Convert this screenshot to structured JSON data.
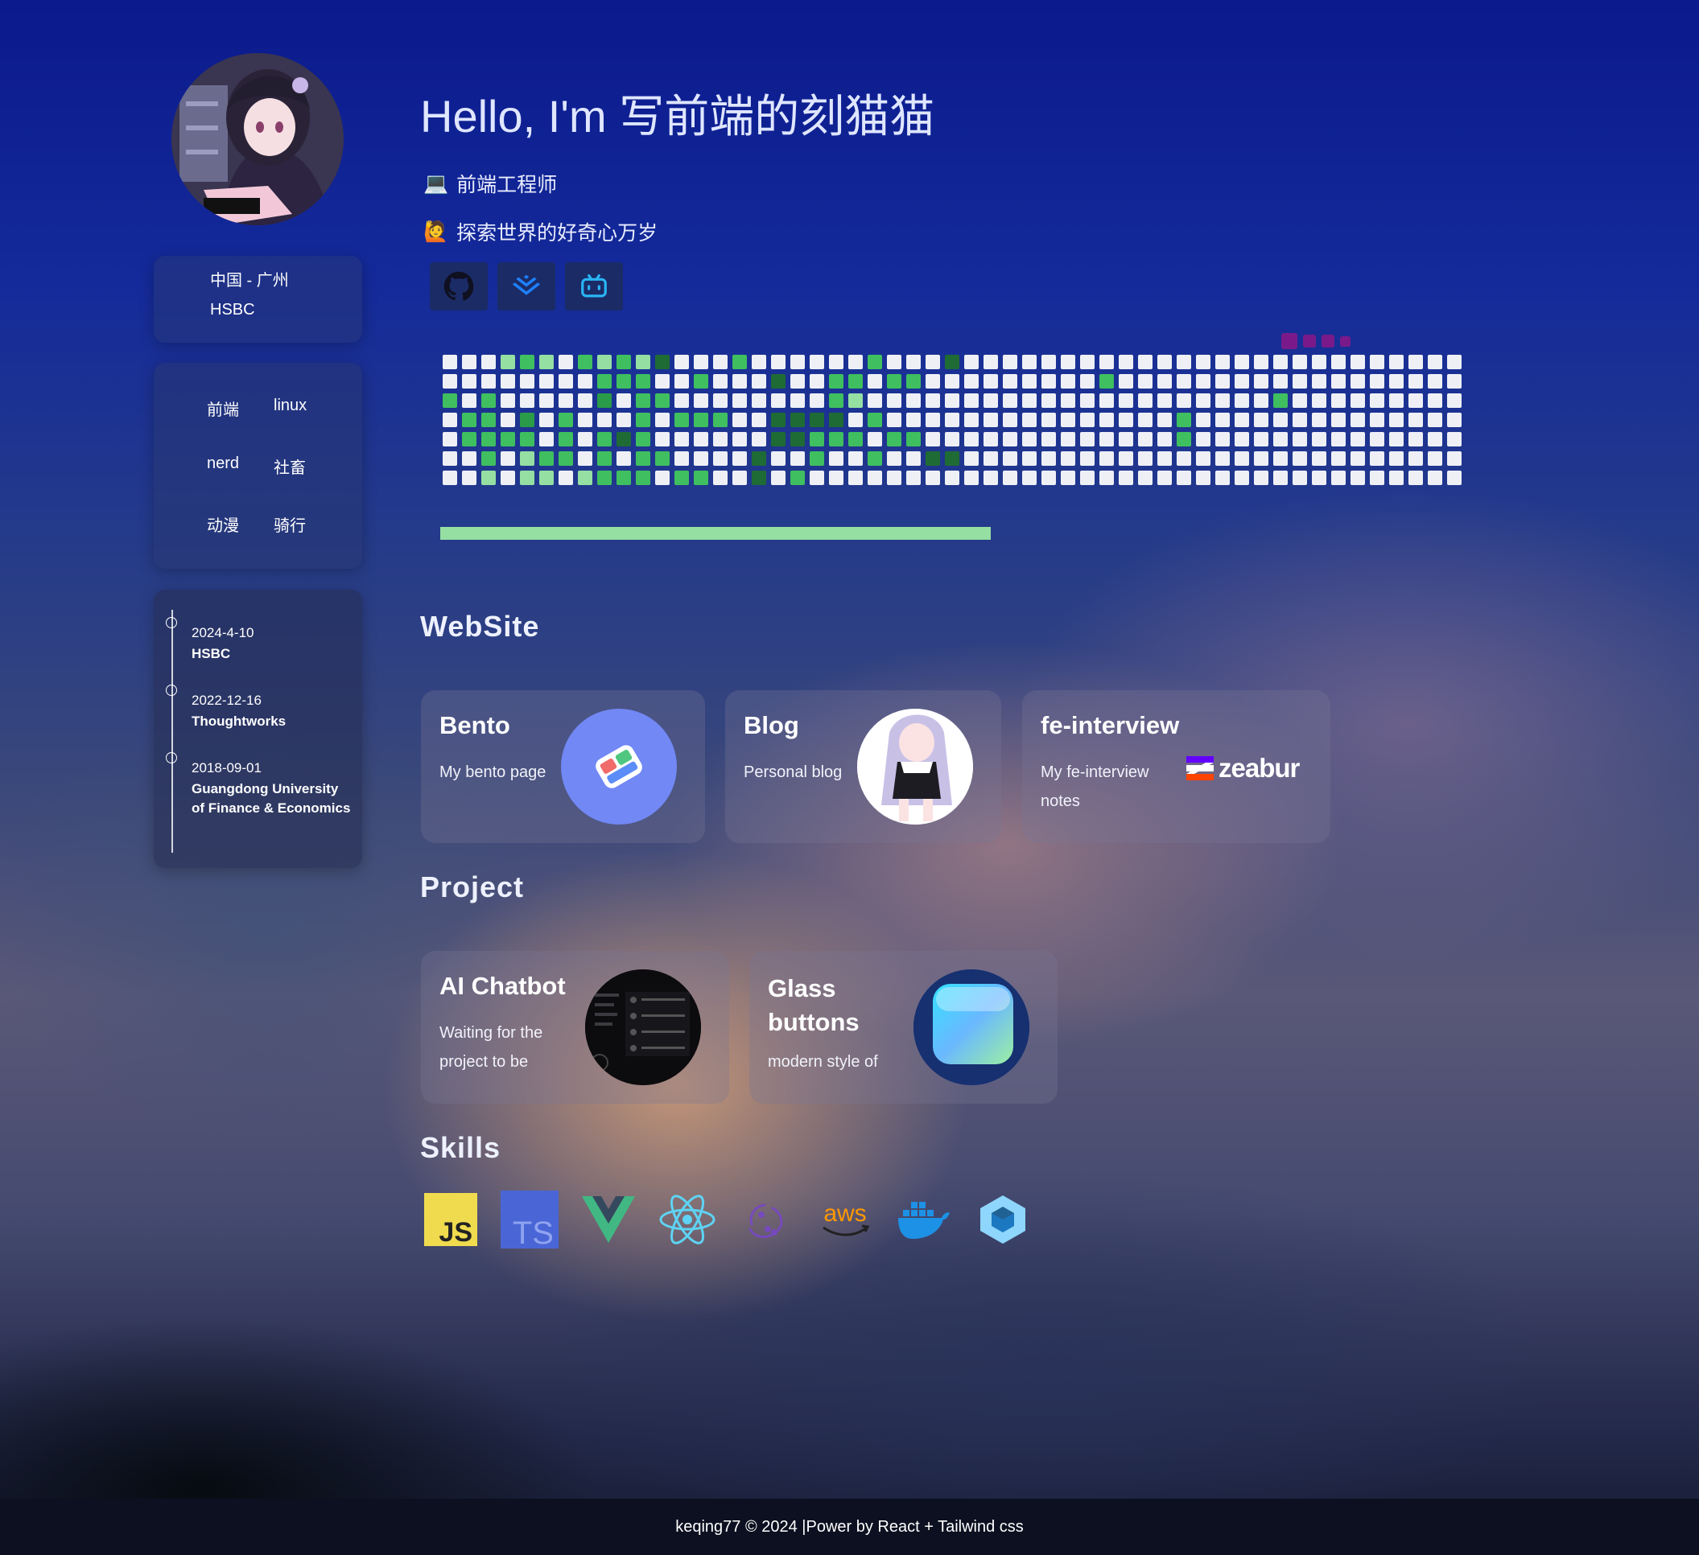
{
  "profile": {
    "location": "中国 - 广州",
    "company": "HSBC",
    "avatar_alt": "anime-girl-avatar"
  },
  "tags": [
    "前端",
    "linux",
    "nerd",
    "社畜",
    "动漫",
    "骑行"
  ],
  "timeline": [
    {
      "date": "2024-4-10",
      "org": "HSBC"
    },
    {
      "date": "2022-12-16",
      "org": "Thoughtworks"
    },
    {
      "date": "2018-09-01",
      "org": "Guangdong University of Finance & Economics"
    }
  ],
  "hero": {
    "greeting": "Hello, I'm 写前端的刻猫猫",
    "role_emoji": "💻",
    "role": "前端工程师",
    "motto_emoji": "🙋",
    "motto": "探索世界的好奇心万岁"
  },
  "socials": [
    {
      "icon": "github-icon"
    },
    {
      "icon": "juejin-icon"
    },
    {
      "icon": "bilibili-icon"
    }
  ],
  "contributions": {
    "weeks": 53,
    "levels_by_week": [
      [
        0,
        0,
        3,
        0,
        0,
        0,
        0
      ],
      [
        0,
        0,
        0,
        3,
        3,
        0,
        0
      ],
      [
        0,
        0,
        3,
        3,
        3,
        3,
        2
      ],
      [
        2,
        0,
        0,
        0,
        3,
        0,
        0
      ],
      [
        3,
        0,
        0,
        4,
        3,
        2,
        2
      ],
      [
        2,
        0,
        0,
        0,
        0,
        3,
        2
      ],
      [
        0,
        0,
        0,
        3,
        3,
        3,
        0
      ],
      [
        3,
        0,
        0,
        0,
        0,
        0,
        2
      ],
      [
        2,
        3,
        4,
        0,
        3,
        3,
        3
      ],
      [
        3,
        3,
        0,
        0,
        5,
        0,
        3
      ],
      [
        2,
        3,
        3,
        3,
        3,
        3,
        3
      ],
      [
        5,
        0,
        3,
        0,
        0,
        3,
        0
      ],
      [
        0,
        0,
        0,
        3,
        0,
        0,
        3
      ],
      [
        0,
        3,
        0,
        3,
        0,
        0,
        3
      ],
      [
        0,
        0,
        0,
        3,
        0,
        0,
        0
      ],
      [
        3,
        0,
        0,
        0,
        0,
        0,
        0
      ],
      [
        0,
        0,
        0,
        0,
        0,
        5,
        5
      ],
      [
        0,
        5,
        0,
        5,
        5,
        0,
        0
      ],
      [
        0,
        0,
        0,
        5,
        5,
        0,
        3
      ],
      [
        0,
        0,
        0,
        5,
        3,
        3,
        0
      ],
      [
        0,
        3,
        3,
        5,
        3,
        0,
        0
      ],
      [
        0,
        3,
        2,
        0,
        3,
        0,
        0
      ],
      [
        3,
        0,
        0,
        3,
        0,
        3,
        0
      ],
      [
        0,
        3,
        0,
        0,
        3,
        0,
        0
      ],
      [
        0,
        3,
        0,
        0,
        3,
        0,
        0
      ],
      [
        0,
        0,
        0,
        0,
        0,
        5,
        0
      ],
      [
        5,
        0,
        0,
        0,
        0,
        5,
        0
      ],
      [
        0,
        0,
        0,
        0,
        0,
        0,
        0
      ],
      [
        0,
        0,
        0,
        0,
        0,
        0,
        0
      ],
      [
        0,
        0,
        0,
        0,
        0,
        0,
        0
      ],
      [
        0,
        0,
        0,
        0,
        0,
        0,
        0
      ],
      [
        0,
        0,
        0,
        0,
        0,
        0,
        0
      ],
      [
        0,
        0,
        0,
        0,
        0,
        0,
        0
      ],
      [
        0,
        0,
        0,
        0,
        0,
        0,
        0
      ],
      [
        0,
        3,
        0,
        0,
        0,
        0,
        0
      ],
      [
        0,
        0,
        0,
        0,
        0,
        0,
        0
      ],
      [
        0,
        0,
        0,
        0,
        0,
        0,
        0
      ],
      [
        0,
        0,
        0,
        0,
        0,
        0,
        0
      ],
      [
        0,
        0,
        0,
        3,
        3,
        0,
        0
      ],
      [
        0,
        0,
        0,
        0,
        0,
        0,
        0
      ],
      [
        0,
        0,
        0,
        0,
        0,
        0,
        0
      ],
      [
        0,
        0,
        0,
        0,
        0,
        0,
        0
      ],
      [
        0,
        0,
        0,
        0,
        0,
        0,
        0
      ],
      [
        0,
        0,
        3,
        0,
        0,
        0,
        0
      ],
      [
        0,
        0,
        0,
        0,
        0,
        0,
        0
      ],
      [
        0,
        0,
        0,
        0,
        0,
        0,
        0
      ],
      [
        0,
        0,
        0,
        0,
        0,
        0,
        0
      ],
      [
        0,
        0,
        0,
        0,
        0,
        0,
        0
      ],
      [
        0,
        0,
        0,
        0,
        0,
        0,
        0
      ],
      [
        0,
        0,
        0,
        0,
        0,
        0,
        0
      ],
      [
        0,
        0,
        0,
        0,
        0,
        0,
        0
      ],
      [
        0,
        0,
        0,
        0,
        0,
        0,
        0
      ],
      [
        0,
        0,
        0,
        0,
        0,
        0,
        0
      ]
    ],
    "level_colors": [
      "#eef0f6",
      "#c6e9cc",
      "#95dfa2",
      "#3fbf5f",
      "#2a9b48",
      "#1f6b35"
    ],
    "legend_color": "#7a1a8a",
    "progress_fraction": 0.54
  },
  "sections": {
    "website": "WebSite",
    "project": "Project",
    "skills": "Skills"
  },
  "websites": [
    {
      "title": "Bento",
      "desc": "My bento page",
      "image": "bento-logo"
    },
    {
      "title": "Blog",
      "desc": "Personal blog",
      "image": "anime-blog-avatar"
    },
    {
      "title": "fe-interview",
      "desc": "My fe-interview notes",
      "image": "zeabur-logo",
      "logo_text": "zeabur"
    }
  ],
  "projects": [
    {
      "title": "AI Chatbot",
      "desc": "Waiting for the project to be",
      "image": "chatbot-screenshot"
    },
    {
      "title": "Glass buttons",
      "desc": "modern style of",
      "image": "glass-button-preview"
    }
  ],
  "skills": [
    {
      "name": "javascript-icon",
      "label": "JS",
      "color": "#f0db4f"
    },
    {
      "name": "typescript-icon",
      "label": "TS",
      "color": "#3178c6"
    },
    {
      "name": "vue-icon",
      "color": "#41b883"
    },
    {
      "name": "react-icon",
      "color": "#5ed3f3"
    },
    {
      "name": "redux-icon",
      "color": "#764abc"
    },
    {
      "name": "aws-icon",
      "label": "aws",
      "color": "#ff9900"
    },
    {
      "name": "docker-icon",
      "color": "#1d91e6"
    },
    {
      "name": "webpack-icon",
      "color": "#8ed6fb"
    }
  ],
  "footer": {
    "text": "keqing77 © 2024 |Power by React + Tailwind css"
  }
}
